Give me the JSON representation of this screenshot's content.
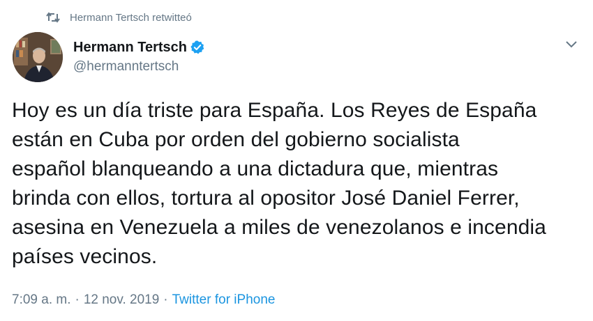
{
  "retweet": {
    "icon": "retweet-icon",
    "text": "Hermann Tertsch retwitteó"
  },
  "author": {
    "display_name": "Hermann Tertsch",
    "handle": "@hermanntertsch",
    "verified": true,
    "verified_color": "#1da1f2"
  },
  "tweet": {
    "lines": [
      "Hoy es un día triste para España. Los Reyes de España",
      "están en Cuba por orden del gobierno socialista",
      "español blanqueando a una dictadura que, mientras",
      "brinda con ellos, tortura al opositor José Daniel Ferrer,",
      "asesina en Venezuela a miles de venezolanos e incendia",
      "países vecinos."
    ]
  },
  "meta": {
    "time": "7:09 a. m.",
    "separator": "·",
    "date": "12 nov. 2019",
    "source": "Twitter for iPhone",
    "source_color": "#1b95e0"
  },
  "colors": {
    "secondary_text": "#657786",
    "primary_text": "#14171a"
  }
}
